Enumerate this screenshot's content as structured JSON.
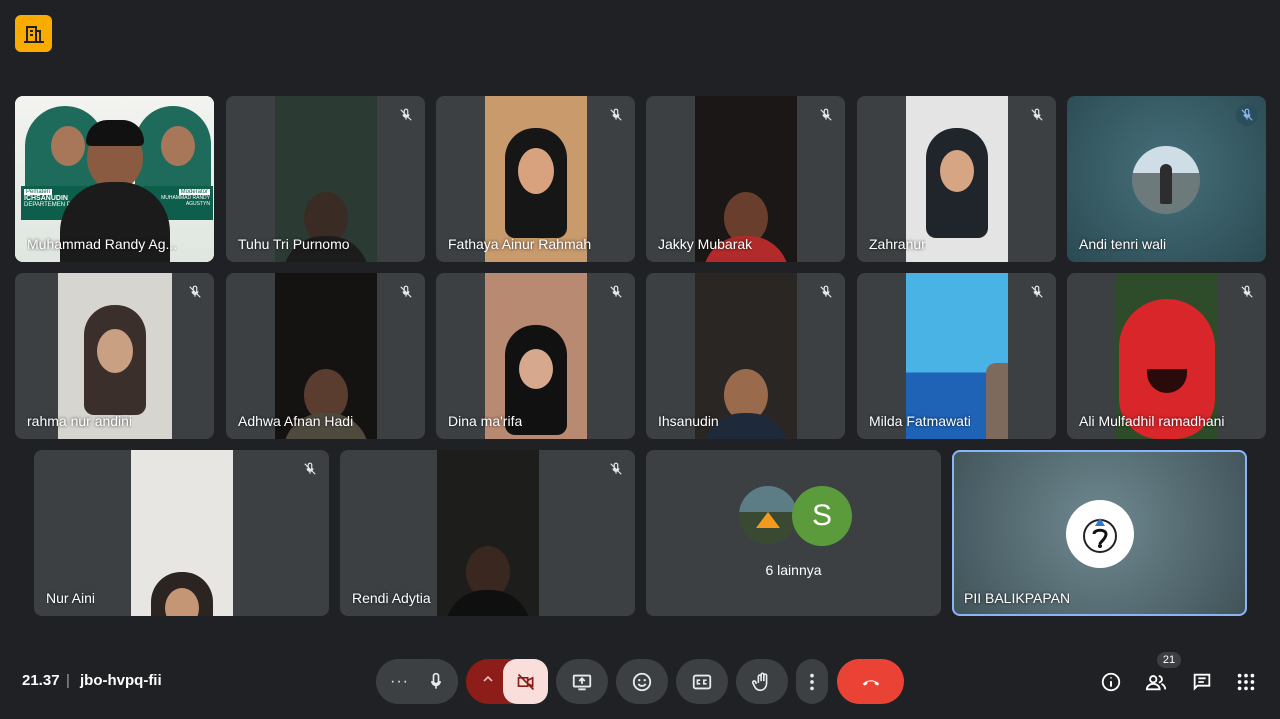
{
  "brand": {
    "logo": "meeting-logo"
  },
  "participants": [
    {
      "name": "Muhammad Randy Ag..."
    },
    {
      "name": "Tuhu Tri Purnomo"
    },
    {
      "name": "Fathaya Ainur Rahmah"
    },
    {
      "name": "Jakky Mubarak"
    },
    {
      "name": "Zahranur"
    },
    {
      "name": "Andi tenri wali"
    },
    {
      "name": "rahma nur andini"
    },
    {
      "name": "Adhwa Afnan Hadi"
    },
    {
      "name": "Dina ma'rifa"
    },
    {
      "name": "Ihsanudin"
    },
    {
      "name": "Milda Fatmawati"
    },
    {
      "name": "Ali Mulfadhil ramadhani"
    },
    {
      "name": "Nur Aini"
    },
    {
      "name": "Rendi Adytia"
    }
  ],
  "overflow": {
    "label": "6 lainnya",
    "avatar_letter": "S"
  },
  "presenter": {
    "name": "PII BALIKPAPAN"
  },
  "banner": {
    "pemateri": "Pemateri",
    "moderator": "Moderator",
    "speaker": "ICHSANUDIN",
    "speaker_title": "DEPARTEMEN PPA",
    "moderator_name": "MUHAMMAD RANDY AGUSTYN"
  },
  "footer": {
    "time": "21.37",
    "separator": "|",
    "meeting_code": "jbo-hvpq-fii",
    "participant_count": "21"
  },
  "colors": {
    "background": "#202124",
    "tile": "#3c4043",
    "end_call": "#ea4335",
    "camera_off": "#f9dedc",
    "active_border": "#8ab4f8"
  }
}
